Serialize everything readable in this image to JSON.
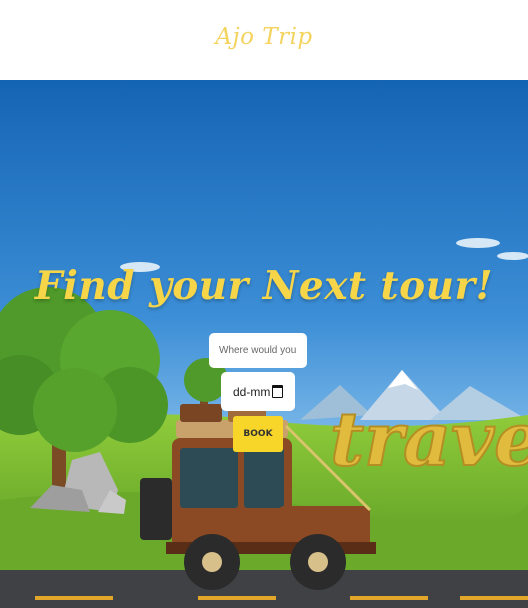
{
  "header": {
    "brand": "Ajo Trip"
  },
  "hero": {
    "title": "Find your Next tour!",
    "sign_text": "trave",
    "form": {
      "destination_placeholder": "Where would you like to go?",
      "destination_value": "",
      "date_placeholder": "dd-mm",
      "book_label": "BOOK"
    }
  },
  "colors": {
    "brand_yellow": "#f4d35e",
    "button_yellow": "#f8d629",
    "sky_blue": "#1d6fc0",
    "grass_green": "#7cb82f"
  }
}
